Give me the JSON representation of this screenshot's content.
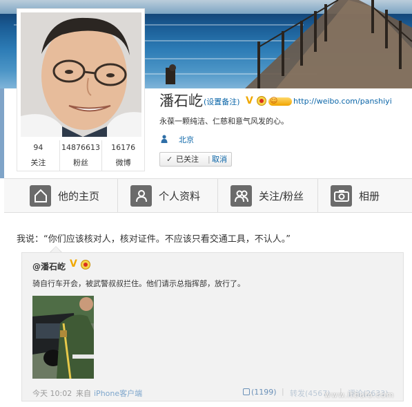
{
  "profile": {
    "name": "潘石屹",
    "remark_link": "(设置备注)",
    "verified_badge": "V",
    "url": "http://weibo.com/panshiyi",
    "bio": "永葆一颗纯洁、仁慈和意气风发的心。",
    "location": "北京",
    "stats": [
      {
        "value": "94",
        "label": "关注"
      },
      {
        "value": "14876613",
        "label": "粉丝"
      },
      {
        "value": "16176",
        "label": "微博"
      }
    ],
    "follow": {
      "check": "✓",
      "status": "已关注",
      "separator": "|",
      "cancel": "取消"
    }
  },
  "nav": {
    "items": [
      {
        "label": "他的主页",
        "icon": "home-icon"
      },
      {
        "label": "个人资料",
        "icon": "person-icon"
      },
      {
        "label": "关注/粉丝",
        "icon": "people-icon"
      },
      {
        "label": "相册",
        "icon": "camera-icon"
      }
    ]
  },
  "post": {
    "text": "我说：“你们应该核对人，核对证件。不应该只看交通工具，不认人。”"
  },
  "repost": {
    "author": "@潘石屹",
    "verified_badge": "V",
    "text": "骑自行车开会，被武警叔叔拦住。他们请示总指挥部，放行了。",
    "time": "今天 10:02",
    "from": "来自",
    "client": "iPhone客户端",
    "like": "(1199)",
    "forward": "转发(4567)",
    "comment": "评论(2633)",
    "separator": "|"
  },
  "watermark": "www.itbulo.com",
  "colors": {
    "link": "#0a65a8",
    "verified": "#f0a800",
    "nav_icon_bg": "#6b6b6b"
  }
}
